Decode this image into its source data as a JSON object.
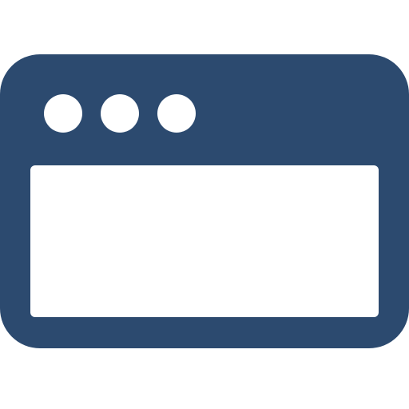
{
  "icon": {
    "name": "browser-window-icon",
    "color": "#2c4a6f",
    "background": "#ffffff"
  },
  "title_bar": {
    "dots": [
      "dot-1",
      "dot-2",
      "dot-3"
    ],
    "dot_color": "#ffffff"
  },
  "content_area": {
    "color": "#ffffff"
  }
}
